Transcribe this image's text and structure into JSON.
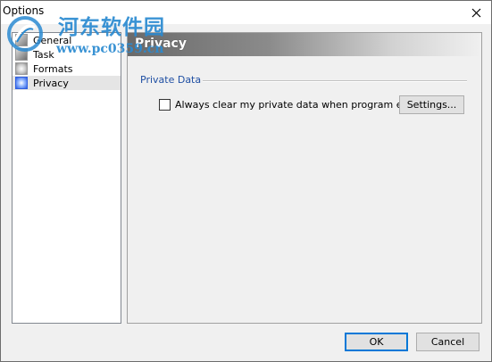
{
  "window": {
    "title": "Options"
  },
  "watermark": {
    "chinese_text": "河东软件园",
    "url": "www.pc0359.cn"
  },
  "sidebar": {
    "items": [
      {
        "label": "General",
        "icon": "general-icon"
      },
      {
        "label": "Task",
        "icon": "task-icon"
      },
      {
        "label": "Formats",
        "icon": "formats-icon"
      },
      {
        "label": "Privacy",
        "icon": "privacy-icon",
        "selected": true
      }
    ]
  },
  "panel": {
    "title": "Privacy",
    "group_label": "Private Data",
    "checkbox_label": "Always clear my private data when program exits",
    "checkbox_checked": false,
    "settings_button": "Settings..."
  },
  "footer": {
    "ok_label": "OK",
    "cancel_label": "Cancel"
  },
  "colors": {
    "group_label": "#1f4fa3",
    "accent_focus": "#0078d7",
    "watermark": "#2a8ad1"
  }
}
